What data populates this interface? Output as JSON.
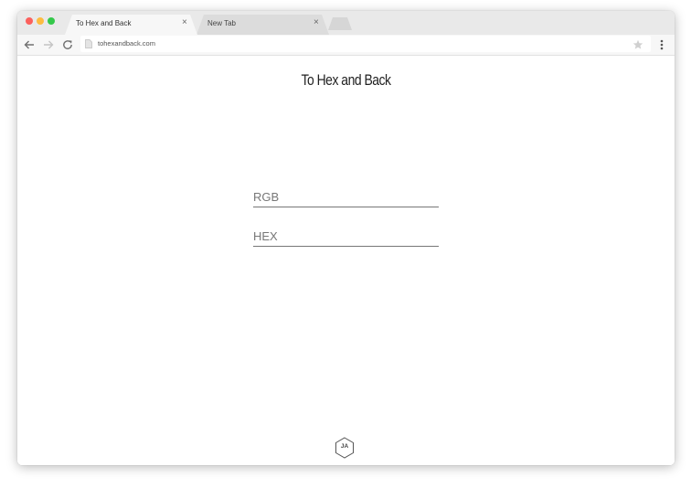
{
  "browser": {
    "tabs": [
      {
        "title": "To Hex and Back",
        "close": "×"
      },
      {
        "title": "New Tab",
        "close": "×"
      }
    ],
    "address": "tohexandback.com",
    "icons": [
      "back-icon",
      "forward-icon",
      "reload-icon",
      "page-icon",
      "star-icon",
      "menu-icon"
    ]
  },
  "page": {
    "title": "To Hex and Back",
    "rgb_placeholder": "RGB",
    "hex_placeholder": "HEX",
    "logo_text": "JA"
  }
}
